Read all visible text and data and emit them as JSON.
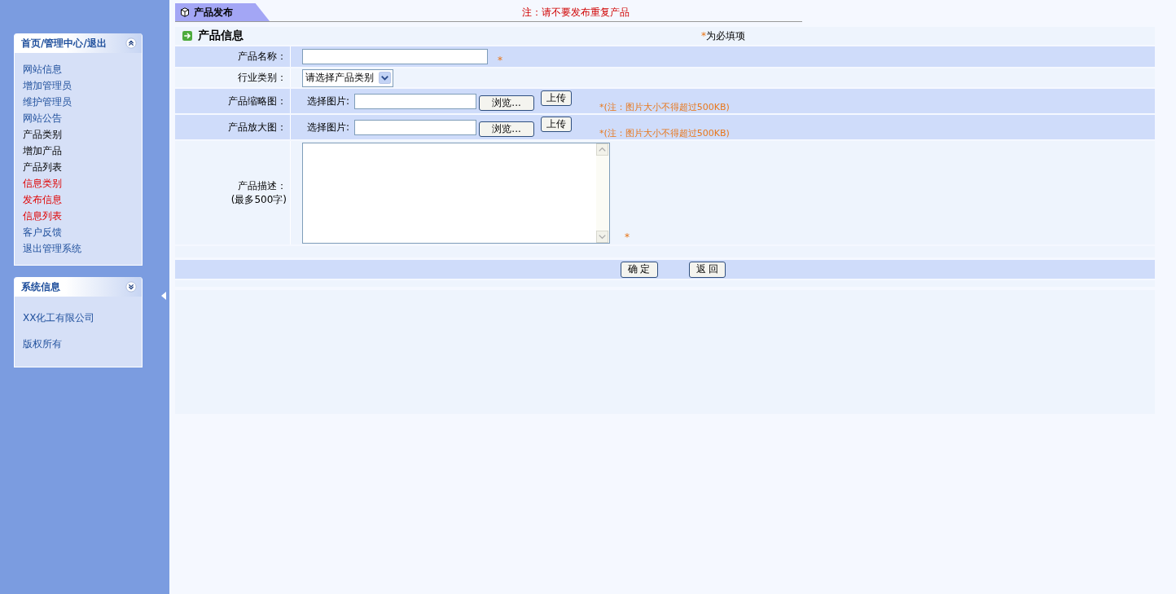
{
  "sidebar": {
    "panels": [
      {
        "title": "首页/管理中心/退出",
        "items": [
          {
            "label": "网站信息",
            "kind": "link"
          },
          {
            "label": "增加管理员",
            "kind": "link"
          },
          {
            "label": "维护管理员",
            "kind": "link"
          },
          {
            "label": "网站公告",
            "kind": "link"
          },
          {
            "label": "产品类别",
            "kind": "plain"
          },
          {
            "label": "增加产品",
            "kind": "plain"
          },
          {
            "label": "产品列表",
            "kind": "plain"
          },
          {
            "label": "信息类别",
            "kind": "alert"
          },
          {
            "label": "发布信息",
            "kind": "alert"
          },
          {
            "label": "信息列表",
            "kind": "alert"
          },
          {
            "label": "客户反馈",
            "kind": "link"
          },
          {
            "label": "退出管理系统",
            "kind": "link"
          }
        ]
      },
      {
        "title": "系统信息",
        "items": [
          {
            "label": "XX化工有限公司",
            "kind": "link"
          },
          {
            "label": "版权所有",
            "kind": "link"
          }
        ]
      }
    ]
  },
  "tab": {
    "label": "产品发布",
    "selected": true
  },
  "notice": "注：请不要发布重复产品",
  "section": {
    "title": "产品信息",
    "required_mark": "*",
    "required_text": "为必填项"
  },
  "form": {
    "rows": [
      {
        "kind": "text",
        "label": "产品名称：",
        "required": "*"
      },
      {
        "kind": "select",
        "label": "行业类别：",
        "value": "请选择产品类别"
      },
      {
        "kind": "file",
        "label": "产品缩略图：",
        "prefix": "选择图片:",
        "browse": "浏览...",
        "upload": "上传",
        "note": "*(注：图片大小不得超过500KB)"
      },
      {
        "kind": "file",
        "label": "产品放大图：",
        "prefix": "选择图片:",
        "browse": "浏览...",
        "upload": "上传",
        "note": "*(注：图片大小不得超过500KB)"
      },
      {
        "kind": "textarea",
        "label": "产品描述：",
        "sublabel": "(最多500字)",
        "required": "*"
      }
    ],
    "buttons": [
      "确 定",
      "返 回"
    ]
  }
}
